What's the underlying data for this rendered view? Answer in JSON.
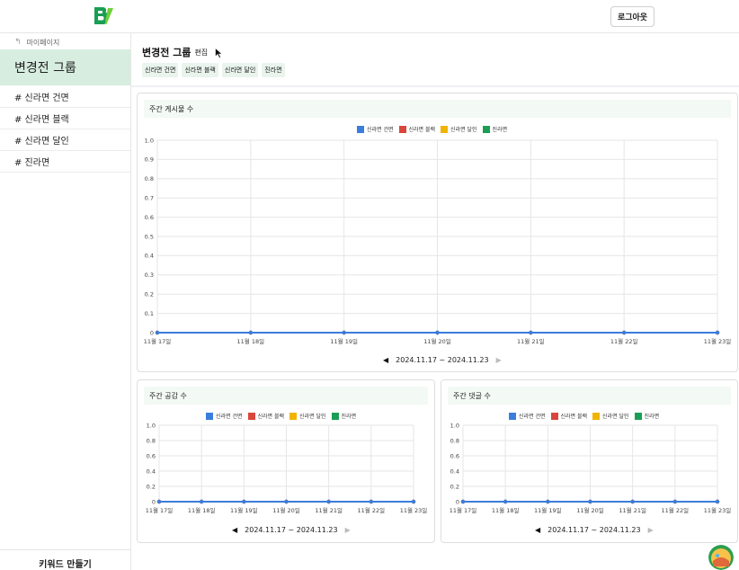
{
  "header": {
    "logout_label": "로그아웃",
    "logo_icon": "logo-icon",
    "logo_color": "#1a9e54"
  },
  "sidebar": {
    "mypage_label": "마이페이지",
    "group_title": "변경전 그룹",
    "items": [
      {
        "label": "# 신라면 건면"
      },
      {
        "label": "# 신라면 블랙"
      },
      {
        "label": "# 신라면 달인"
      },
      {
        "label": "# 진라면"
      }
    ],
    "keyword_button": "키워드 만들기"
  },
  "main": {
    "group_name": "변경전 그룹",
    "edit_label": "편집",
    "tags": [
      "신라면 건면",
      "신라면 블랙",
      "신라면 달인",
      "진라면"
    ]
  },
  "colors": {
    "series": [
      "#3b7ddd",
      "#d9463c",
      "#f0b400",
      "#1a9e54"
    ],
    "accent_bg": "#d6ede0"
  },
  "chart_data": [
    {
      "type": "line",
      "title": "주간 게시물 수",
      "x": [
        "11월 17일",
        "11월 18일",
        "11월 19일",
        "11월 20일",
        "11월 21일",
        "11월 22일",
        "11월 23일"
      ],
      "series": [
        {
          "name": "신라면 건면",
          "values": [
            0,
            0,
            0,
            0,
            0,
            0,
            0
          ]
        },
        {
          "name": "신라면 블랙",
          "values": [
            0,
            0,
            0,
            0,
            0,
            0,
            0
          ]
        },
        {
          "name": "신라면 달인",
          "values": [
            0,
            0,
            0,
            0,
            0,
            0,
            0
          ]
        },
        {
          "name": "진라면",
          "values": [
            0,
            0,
            0,
            0,
            0,
            0,
            0
          ]
        }
      ],
      "yticks": [
        "0",
        "0.1",
        "0.2",
        "0.3",
        "0.4",
        "0.5",
        "0.6",
        "0.7",
        "0.8",
        "0.9",
        "1.0"
      ],
      "ylim": [
        0,
        1
      ],
      "grid": true,
      "legend": "top-center",
      "range_label": "2024.11.17 ~ 2024.11.23"
    },
    {
      "type": "line",
      "title": "주간 공감 수",
      "x": [
        "11월 17일",
        "11월 18일",
        "11월 19일",
        "11월 20일",
        "11월 21일",
        "11월 22일",
        "11월 23일"
      ],
      "series": [
        {
          "name": "신라면 건면",
          "values": [
            0,
            0,
            0,
            0,
            0,
            0,
            0
          ]
        },
        {
          "name": "신라면 블랙",
          "values": [
            0,
            0,
            0,
            0,
            0,
            0,
            0
          ]
        },
        {
          "name": "신라면 달인",
          "values": [
            0,
            0,
            0,
            0,
            0,
            0,
            0
          ]
        },
        {
          "name": "진라면",
          "values": [
            0,
            0,
            0,
            0,
            0,
            0,
            0
          ]
        }
      ],
      "yticks": [
        "0",
        "0.2",
        "0.4",
        "0.6",
        "0.8",
        "1.0"
      ],
      "ylim": [
        0,
        1
      ],
      "grid": true,
      "legend": "top-center",
      "range_label": "2024.11.17 ~ 2024.11.23"
    },
    {
      "type": "line",
      "title": "주간 댓글 수",
      "x": [
        "11월 17일",
        "11월 18일",
        "11월 19일",
        "11월 20일",
        "11월 21일",
        "11월 22일",
        "11월 23일"
      ],
      "series": [
        {
          "name": "신라면 건면",
          "values": [
            0,
            0,
            0,
            0,
            0,
            0,
            0
          ]
        },
        {
          "name": "신라면 블랙",
          "values": [
            0,
            0,
            0,
            0,
            0,
            0,
            0
          ]
        },
        {
          "name": "신라면 달인",
          "values": [
            0,
            0,
            0,
            0,
            0,
            0,
            0
          ]
        },
        {
          "name": "진라면",
          "values": [
            0,
            0,
            0,
            0,
            0,
            0,
            0
          ]
        }
      ],
      "yticks": [
        "0",
        "0.2",
        "0.4",
        "0.6",
        "0.8",
        "1.0"
      ],
      "ylim": [
        0,
        1
      ],
      "grid": true,
      "legend": "top-center",
      "range_label": "2024.11.17 ~ 2024.11.23"
    }
  ]
}
